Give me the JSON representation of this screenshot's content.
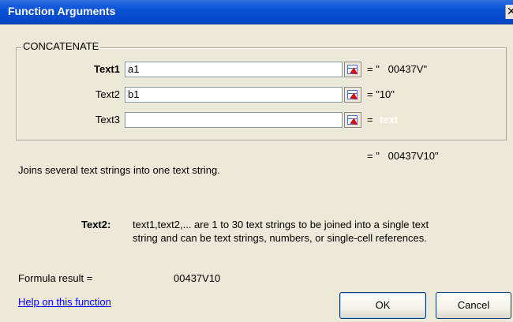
{
  "window": {
    "title": "Function Arguments",
    "close_glyph": "✕"
  },
  "function_group": {
    "name": "CONCATENATE",
    "args": [
      {
        "label": "Text1",
        "value": "a1",
        "result": "= \"   00437V\""
      },
      {
        "label": "Text2",
        "value": "b1",
        "result": "= \"10\""
      },
      {
        "label": "Text3",
        "value": "",
        "result_prefix": "=",
        "result": "text"
      }
    ]
  },
  "overall_result": "= \"   00437V10\"",
  "description": "Joins several text strings into one text string.",
  "arg_help": {
    "name": "Text2:",
    "line1": "text1,text2,... are 1 to 30 text strings to be joined into a single text",
    "line2": "string and can be text strings, numbers, or single-cell references."
  },
  "formula_result": {
    "label": "Formula result =",
    "value": "00437V10"
  },
  "help_link": "Help on this function",
  "buttons": {
    "ok": "OK",
    "cancel": "Cancel"
  },
  "icons": {
    "collapse_dialog": "collapse-dialog-icon",
    "close": "close-icon"
  }
}
